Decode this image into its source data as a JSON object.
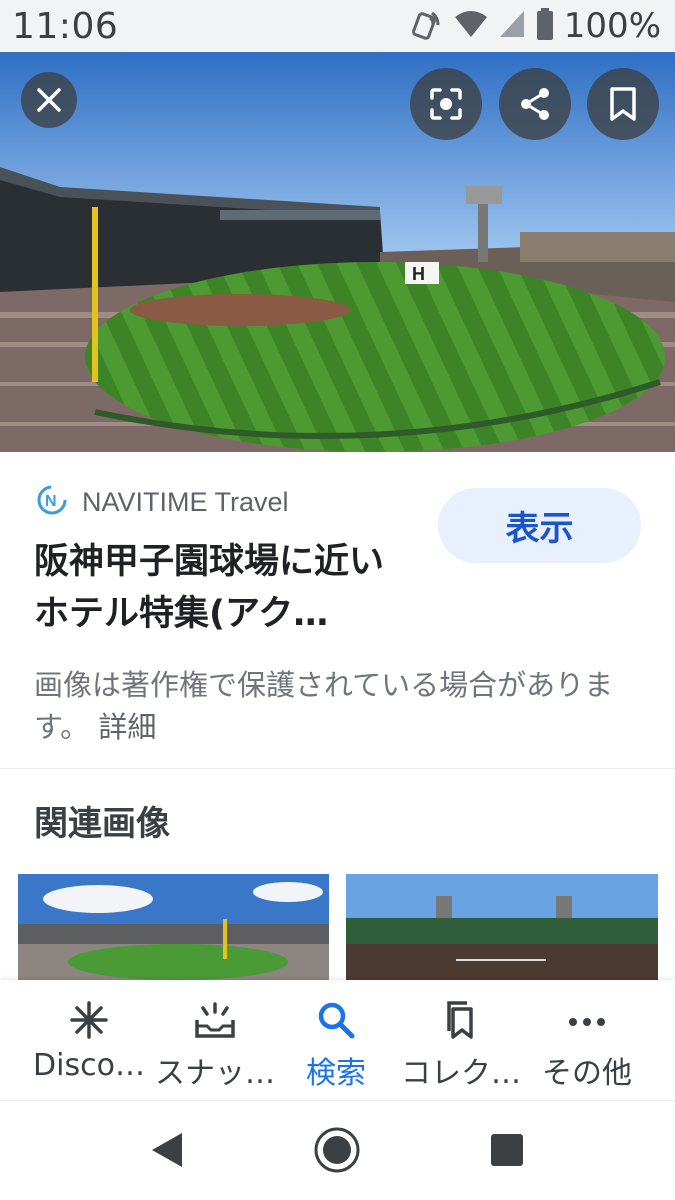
{
  "status_bar": {
    "time": "11:06",
    "battery_percent": "100%",
    "icons": [
      "nfc-icon",
      "wifi-icon",
      "signal-icon",
      "battery-icon"
    ]
  },
  "hero": {
    "image_description_icon": "stadium-photo",
    "buttons": [
      "close-icon",
      "lens-icon",
      "share-icon",
      "bookmark-icon"
    ]
  },
  "result": {
    "source_name": "NAVITIME Travel",
    "title": "阪神甲子園球場に近いホテル特集(アク…",
    "view_button_label": "表示",
    "copyright_text": "画像は著作権で保護されている場合があります。",
    "details_link": "詳細"
  },
  "related": {
    "heading": "関連画像"
  },
  "bottom_nav": {
    "items": [
      {
        "label": "Disco…",
        "icon": "asterisk-icon",
        "active": false
      },
      {
        "label": "スナッ…",
        "icon": "snapshot-tray-icon",
        "active": false
      },
      {
        "label": "検索",
        "icon": "search-icon",
        "active": true
      },
      {
        "label": "コレク…",
        "icon": "collections-icon",
        "active": false
      },
      {
        "label": "その他",
        "icon": "more-dots-icon",
        "active": false
      }
    ]
  },
  "colors": {
    "accent": "#1a73e8",
    "view_button_bg": "#e8f0fe",
    "status_bar_bg": "#f1f3f4"
  }
}
